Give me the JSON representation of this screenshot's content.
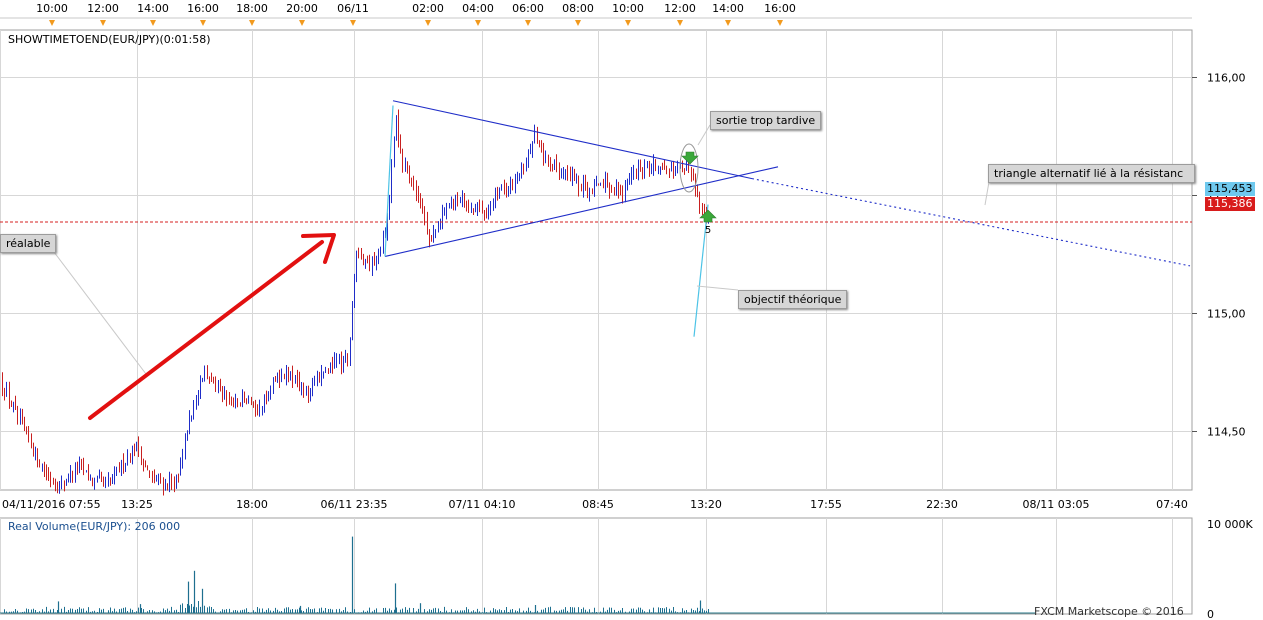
{
  "chart_data": {
    "type": "candlestick",
    "symbol_label": "SHOWTIMETOEND(EUR/JPY)(0:01:58)",
    "volume_label": "Real Volume(EUR/JPY): 206 000",
    "watermark": "FXCM Marketscope © 2016",
    "top_time_ticks": [
      "10:00",
      "12:00",
      "14:00",
      "16:00",
      "18:00",
      "20:00",
      "06/11",
      "02:00",
      "04:00",
      "06:00",
      "08:00",
      "10:00",
      "12:00",
      "14:00",
      "16:00"
    ],
    "x_ticks": [
      "04/11/2016 07:55",
      "13:25",
      "18:00",
      "06/11 23:35",
      "07/11 04:10",
      "08:45",
      "13:20",
      "17:55",
      "22:30",
      "08/11 03:05",
      "07:40"
    ],
    "y_ticks": [
      "116,00",
      "115,50",
      "115,00",
      "114,50"
    ],
    "y_range": [
      114.25,
      116.2
    ],
    "current_price_tag": "115,453",
    "current_price": 115.453,
    "red_line_tag": "115,386",
    "red_line": 115.386,
    "volume_ticks": [
      "10 000K",
      "0"
    ],
    "volume_range": [
      0,
      10000
    ],
    "annotations": [
      {
        "id": "prealable",
        "text": "réalable"
      },
      {
        "id": "sortie",
        "text": "sortie trop tardive"
      },
      {
        "id": "triangle",
        "text": "triangle alternatif lié à la résistanc"
      },
      {
        "id": "objectif",
        "text": "objectif théorique"
      }
    ],
    "marker_label": "5",
    "series": [
      {
        "name": "EUR/JPY",
        "anchors": [
          [
            0,
            114.72
          ],
          [
            15,
            114.58
          ],
          [
            35,
            114.4
          ],
          [
            50,
            114.3
          ],
          [
            62,
            114.27
          ],
          [
            78,
            114.36
          ],
          [
            92,
            114.28
          ],
          [
            110,
            114.28
          ],
          [
            122,
            114.36
          ],
          [
            135,
            114.44
          ],
          [
            150,
            114.3
          ],
          [
            165,
            114.27
          ],
          [
            178,
            114.3
          ],
          [
            192,
            114.6
          ],
          [
            205,
            114.75
          ],
          [
            215,
            114.72
          ],
          [
            230,
            114.6
          ],
          [
            245,
            114.64
          ],
          [
            260,
            114.58
          ],
          [
            275,
            114.72
          ],
          [
            290,
            114.74
          ],
          [
            305,
            114.66
          ],
          [
            320,
            114.72
          ],
          [
            335,
            114.8
          ],
          [
            348,
            114.8
          ],
          [
            352,
            115.05
          ],
          [
            356,
            115.26
          ],
          [
            362,
            115.24
          ],
          [
            370,
            115.2
          ],
          [
            378,
            115.25
          ],
          [
            385,
            115.35
          ],
          [
            390,
            115.55
          ],
          [
            395,
            115.85
          ],
          [
            400,
            115.68
          ],
          [
            405,
            115.62
          ],
          [
            412,
            115.55
          ],
          [
            420,
            115.48
          ],
          [
            428,
            115.32
          ],
          [
            435,
            115.34
          ],
          [
            445,
            115.45
          ],
          [
            455,
            115.5
          ],
          [
            470,
            115.45
          ],
          [
            485,
            115.42
          ],
          [
            500,
            115.52
          ],
          [
            515,
            115.55
          ],
          [
            525,
            115.65
          ],
          [
            535,
            115.76
          ],
          [
            545,
            115.64
          ],
          [
            560,
            115.6
          ],
          [
            575,
            115.56
          ],
          [
            590,
            115.52
          ],
          [
            605,
            115.55
          ],
          [
            620,
            115.5
          ],
          [
            635,
            115.6
          ],
          [
            650,
            115.62
          ],
          [
            665,
            115.61
          ],
          [
            680,
            115.63
          ],
          [
            690,
            115.6
          ],
          [
            698,
            115.5
          ],
          [
            702,
            115.42
          ],
          [
            706,
            115.4
          ],
          [
            710,
            115.45
          ]
        ]
      }
    ],
    "volume_spikes": [
      {
        "x": 352,
        "v": 8600
      },
      {
        "x": 194,
        "v": 4800
      },
      {
        "x": 188,
        "v": 3600
      },
      {
        "x": 202,
        "v": 2800
      },
      {
        "x": 395,
        "v": 3400
      },
      {
        "x": 58,
        "v": 1400
      },
      {
        "x": 140,
        "v": 1100
      },
      {
        "x": 420,
        "v": 1200
      },
      {
        "x": 535,
        "v": 1000
      },
      {
        "x": 700,
        "v": 1500
      },
      {
        "x": 300,
        "v": 900
      }
    ],
    "trendlines": [
      {
        "name": "triangle-top",
        "from": [
          393,
          115.9
        ],
        "to": [
          752,
          115.57
        ]
      },
      {
        "name": "triangle-bottom",
        "from": [
          385,
          115.24
        ],
        "to": [
          778,
          115.62
        ]
      },
      {
        "name": "resistance-dotted",
        "from": [
          752,
          115.57
        ],
        "to": [
          1190,
          115.2
        ]
      }
    ],
    "price_line_pixel_note": "",
    "colors": {
      "up": "#1f2dc8",
      "down": "#c82020",
      "grid": "#d7d7d7",
      "trend": "#1f2dc8",
      "cyan": "#4cc3e6",
      "arrow": "#e21010",
      "tick_marker": "#f29a1e"
    }
  }
}
